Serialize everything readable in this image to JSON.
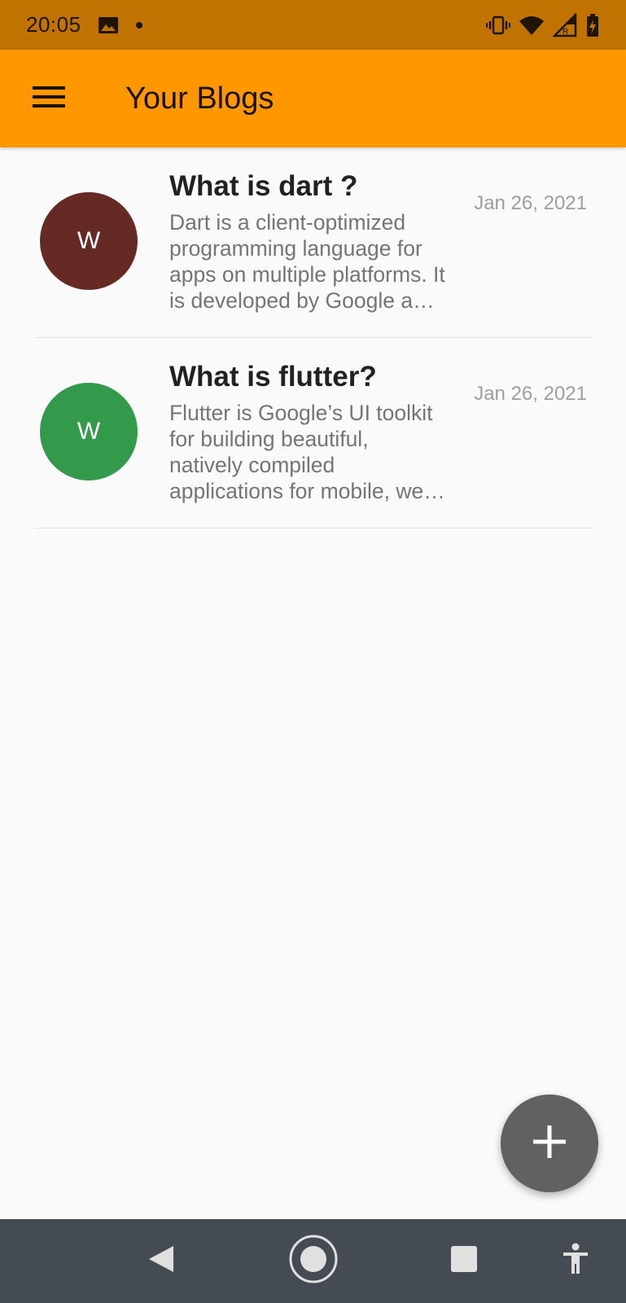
{
  "status_bar": {
    "time": "20:05",
    "icons": [
      "image-icon",
      "notification-dot-icon",
      "vibrate-icon",
      "wifi-icon",
      "signal-roaming-icon",
      "battery-charging-icon"
    ]
  },
  "app_bar": {
    "title": "Your Blogs",
    "menu_icon": "menu-icon",
    "background": "#ff9800"
  },
  "blogs": [
    {
      "avatar_letter": "W",
      "avatar_color": "#662a25",
      "title": "What is dart ?",
      "excerpt": "Dart is a client-optimized programming language for apps on multiple platforms. It is developed by Google and is used to build mobile, desktop, server, and web applications.",
      "date": "Jan 26, 2021"
    },
    {
      "avatar_letter": "W",
      "avatar_color": "#349a4b",
      "title": "What is flutter?",
      "excerpt": "Flutter is Google’s UI toolkit for building beautiful, natively compiled applications for mobile, web, and desktop from a single codebase.",
      "date": "Jan 26, 2021"
    }
  ],
  "fab": {
    "icon": "plus-icon",
    "color": "#616161"
  },
  "nav_bar": {
    "buttons": [
      "back-icon",
      "home-icon",
      "recents-icon",
      "accessibility-icon"
    ]
  }
}
